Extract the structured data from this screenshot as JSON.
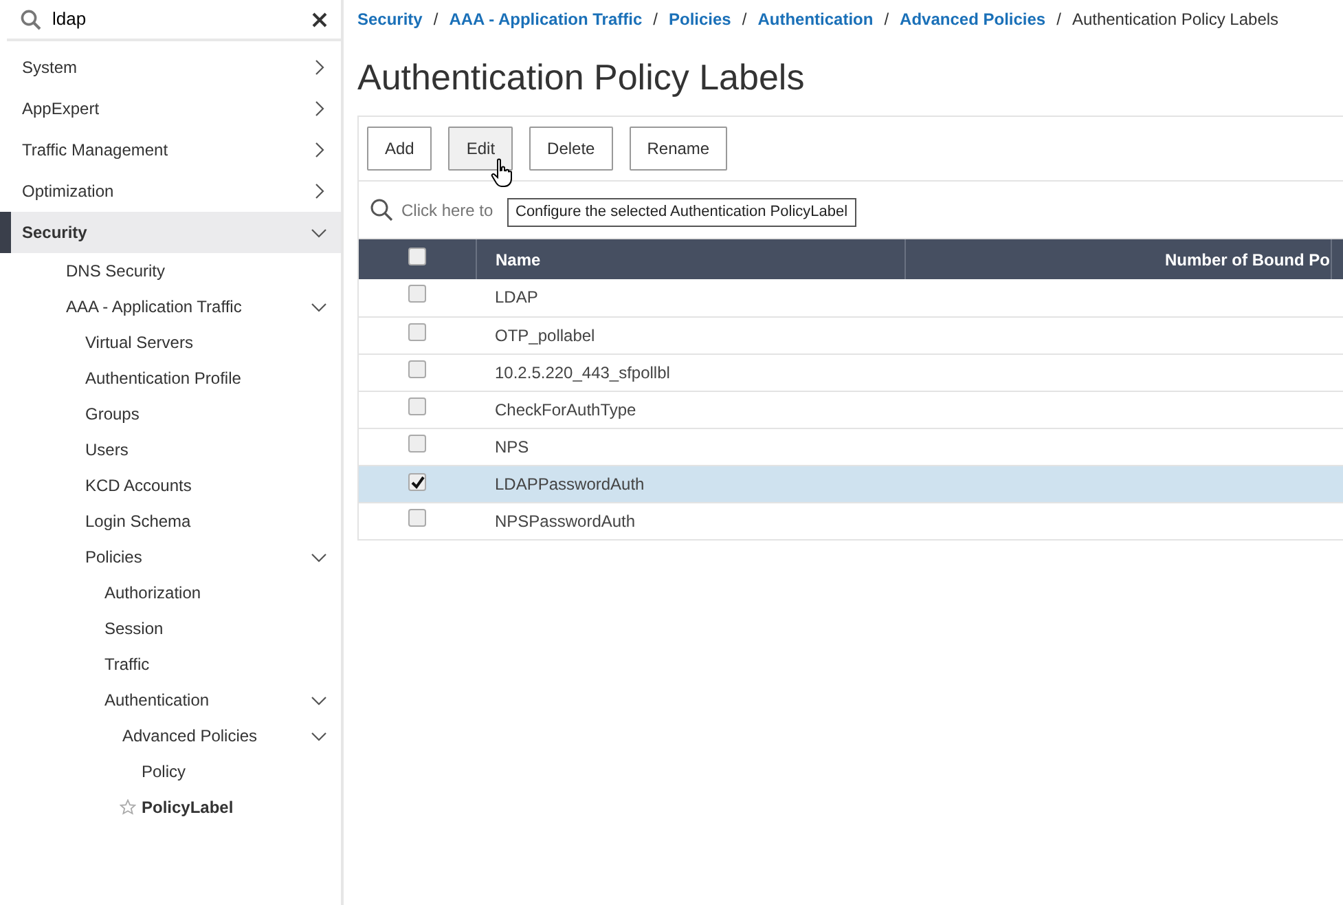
{
  "sidebar": {
    "search": {
      "value": "ldap"
    },
    "items": [
      {
        "label": "System",
        "selected": false,
        "expanded": false
      },
      {
        "label": "AppExpert",
        "selected": false,
        "expanded": false
      },
      {
        "label": "Traffic Management",
        "selected": false,
        "expanded": false
      },
      {
        "label": "Optimization",
        "selected": false,
        "expanded": false
      },
      {
        "label": "Security",
        "selected": true,
        "expanded": true,
        "children": [
          {
            "label": "DNS Security",
            "selected": false
          },
          {
            "label": "AAA - Application Traffic",
            "selected": false,
            "expanded": true,
            "children": [
              {
                "label": "Virtual Servers",
                "selected": false
              },
              {
                "label": "Authentication Profile",
                "selected": false
              },
              {
                "label": "Groups",
                "selected": false
              },
              {
                "label": "Users",
                "selected": false
              },
              {
                "label": "KCD Accounts",
                "selected": false
              },
              {
                "label": "Login Schema",
                "selected": false
              },
              {
                "label": "Policies",
                "selected": false,
                "expanded": true,
                "children": [
                  {
                    "label": "Authorization",
                    "selected": false
                  },
                  {
                    "label": "Session",
                    "selected": false
                  },
                  {
                    "label": "Traffic",
                    "selected": false
                  },
                  {
                    "label": "Authentication",
                    "selected": false,
                    "expanded": true,
                    "children": [
                      {
                        "label": "Advanced Policies",
                        "selected": false,
                        "expanded": true,
                        "children": [
                          {
                            "label": "Policy",
                            "selected": false
                          },
                          {
                            "label": "PolicyLabel",
                            "selected": true
                          }
                        ]
                      }
                    ]
                  }
                ]
              }
            ]
          }
        ]
      }
    ]
  },
  "breadcrumb": [
    {
      "kind": "link",
      "label": "Security"
    },
    {
      "kind": "separator",
      "label": "/"
    },
    {
      "kind": "link",
      "label": "AAA - Application Traffic"
    },
    {
      "kind": "separator",
      "label": "/"
    },
    {
      "kind": "link",
      "label": "Policies"
    },
    {
      "kind": "separator",
      "label": "/"
    },
    {
      "kind": "link",
      "label": "Authentication"
    },
    {
      "kind": "separator",
      "label": "/"
    },
    {
      "kind": "link",
      "label": "Advanced Policies"
    },
    {
      "kind": "separator",
      "label": "/"
    },
    {
      "kind": "current",
      "label": "Authentication Policy Labels"
    }
  ],
  "title": "Authentication Policy Labels",
  "toolbar": [
    "Add",
    "Edit",
    "Delete",
    "Rename"
  ],
  "search": {
    "placeholder": "Click here to"
  },
  "tooltip": "Configure the selected Authentication PolicyLabel",
  "table": {
    "select_all": {
      "checked": false
    },
    "columns": [
      "Name",
      "Number of Bound Po"
    ],
    "rows": [
      {
        "name": "LDAP",
        "selected": false
      },
      {
        "name": "OTP_pollabel",
        "selected": false
      },
      {
        "name": "10.2.5.220_443_sfpollbl",
        "selected": false
      },
      {
        "name": "CheckForAuthType",
        "selected": false
      },
      {
        "name": "NPS",
        "selected": false
      },
      {
        "name": "LDAPPasswordAuth",
        "selected": true
      },
      {
        "name": "NPSPasswordAuth",
        "selected": false
      }
    ]
  }
}
